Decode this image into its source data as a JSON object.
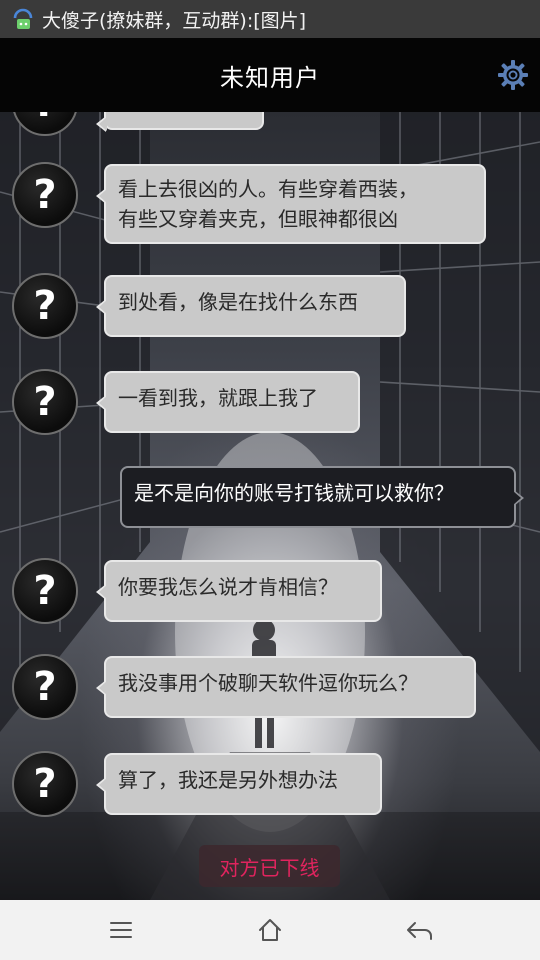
{
  "status_bar": {
    "notification_text": "大傻子(撩妹群，互动群):[图片]",
    "icon": "chat-notification-icon"
  },
  "header": {
    "title": "未知用户",
    "settings_icon": "gear-icon",
    "accent_color": "#5b7fb6"
  },
  "messages": [
    {
      "side": "in",
      "avatar": "?",
      "text": ""
    },
    {
      "side": "in",
      "avatar": "?",
      "lines": [
        "看上去很凶的人。有些穿着西装，",
        "有些又穿着夹克，但眼神都很凶"
      ]
    },
    {
      "side": "in",
      "avatar": "?",
      "text": "到处看，像是在找什么东西"
    },
    {
      "side": "in",
      "avatar": "?",
      "text": "一看到我，就跟上我了"
    },
    {
      "side": "out",
      "text": "是不是向你的账号打钱就可以救你？"
    },
    {
      "side": "in",
      "avatar": "?",
      "text": "你要我怎么说才肯相信？"
    },
    {
      "side": "in",
      "avatar": "?",
      "text": "我没事用个破聊天软件逗你玩么？"
    },
    {
      "side": "in",
      "avatar": "?",
      "text": "算了，我还是另外想办法"
    }
  ],
  "offline_notice": "对方已下线",
  "offline_color": "#e0245e",
  "nav_bar": {
    "menu_icon": "menu-icon",
    "home_icon": "home-icon",
    "back_icon": "back-icon"
  }
}
